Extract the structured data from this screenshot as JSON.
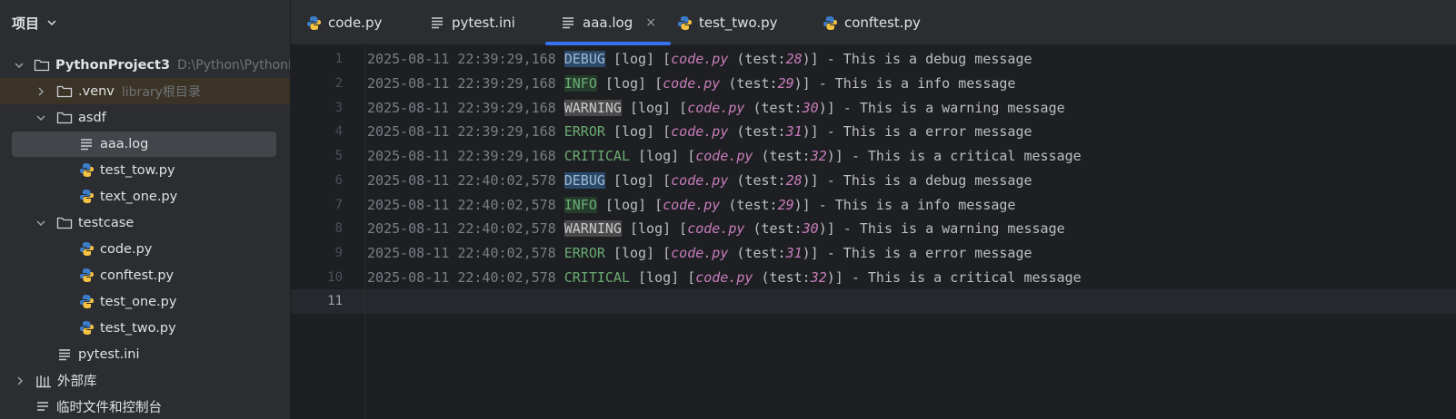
{
  "sidebar": {
    "title": "项目",
    "items": [
      {
        "label": "PythonProject3",
        "hint": "D:\\Python\\PythonP",
        "icon": "folder-icon",
        "expanded": true
      },
      {
        "label": ".venv",
        "hint": "library根目录",
        "icon": "folder-icon",
        "expanded": false
      },
      {
        "label": "asdf",
        "icon": "folder-icon",
        "expanded": true
      },
      {
        "label": "aaa.log",
        "icon": "text-file-icon"
      },
      {
        "label": "test_tow.py",
        "icon": "python-file-icon"
      },
      {
        "label": "text_one.py",
        "icon": "python-file-icon"
      },
      {
        "label": "testcase",
        "icon": "folder-icon",
        "expanded": true
      },
      {
        "label": "code.py",
        "icon": "python-file-icon"
      },
      {
        "label": "conftest.py",
        "icon": "python-file-icon"
      },
      {
        "label": "test_one.py",
        "icon": "python-file-icon"
      },
      {
        "label": "test_two.py",
        "icon": "python-file-icon"
      },
      {
        "label": "pytest.ini",
        "icon": "text-file-icon"
      },
      {
        "label": "外部库",
        "icon": "library-icon",
        "expanded": false
      },
      {
        "label": "临时文件和控制台",
        "icon": "scratch-icon"
      }
    ]
  },
  "tabs": [
    {
      "label": "code.py",
      "icon": "python-file-icon"
    },
    {
      "label": "pytest.ini",
      "icon": "text-file-icon"
    },
    {
      "label": "aaa.log",
      "icon": "text-file-icon",
      "active": true,
      "close": "×"
    },
    {
      "label": "test_two.py",
      "icon": "python-file-icon"
    },
    {
      "label": "conftest.py",
      "icon": "python-file-icon"
    }
  ],
  "editor": {
    "line_numbers": [
      "1",
      "2",
      "3",
      "4",
      "5",
      "6",
      "7",
      "8",
      "9",
      "10",
      "11"
    ],
    "lines": [
      {
        "ts": "2025-08-11 22:39:29,168",
        "level": "DEBUG",
        "sep1": " [log] [",
        "file": "code.py",
        "sep2": " (test:",
        "num": "28",
        "rest": ")] - This is a debug message"
      },
      {
        "ts": "2025-08-11 22:39:29,168",
        "level": "INFO",
        "sep1": " [log] [",
        "file": "code.py",
        "sep2": " (test:",
        "num": "29",
        "rest": ")] - This is a info message"
      },
      {
        "ts": "2025-08-11 22:39:29,168",
        "level": "WARNING",
        "sep1": " [log] [",
        "file": "code.py",
        "sep2": " (test:",
        "num": "30",
        "rest": ")] - This is a warning message"
      },
      {
        "ts": "2025-08-11 22:39:29,168",
        "level": "ERROR",
        "sep1": " [log] [",
        "file": "code.py",
        "sep2": " (test:",
        "num": "31",
        "rest": ")] - This is a error message"
      },
      {
        "ts": "2025-08-11 22:39:29,168",
        "level": "CRITICAL",
        "sep1": " [log] [",
        "file": "code.py",
        "sep2": " (test:",
        "num": "32",
        "rest": ")] - This is a critical message"
      },
      {
        "ts": "2025-08-11 22:40:02,578",
        "level": "DEBUG",
        "sep1": " [log] [",
        "file": "code.py",
        "sep2": " (test:",
        "num": "28",
        "rest": ")] - This is a debug message"
      },
      {
        "ts": "2025-08-11 22:40:02,578",
        "level": "INFO",
        "sep1": " [log] [",
        "file": "code.py",
        "sep2": " (test:",
        "num": "29",
        "rest": ")] - This is a info message"
      },
      {
        "ts": "2025-08-11 22:40:02,578",
        "level": "WARNING",
        "sep1": " [log] [",
        "file": "code.py",
        "sep2": " (test:",
        "num": "30",
        "rest": ")] - This is a warning message"
      },
      {
        "ts": "2025-08-11 22:40:02,578",
        "level": "ERROR",
        "sep1": " [log] [",
        "file": "code.py",
        "sep2": " (test:",
        "num": "31",
        "rest": ")] - This is a error message"
      },
      {
        "ts": "2025-08-11 22:40:02,578",
        "level": "CRITICAL",
        "sep1": " [log] [",
        "file": "code.py",
        "sep2": " (test:",
        "num": "32",
        "rest": ")] - This is a critical message"
      }
    ]
  },
  "colors": {
    "accent": "#3574f0",
    "background": "#1e1f22",
    "panel": "#2b2d30"
  }
}
